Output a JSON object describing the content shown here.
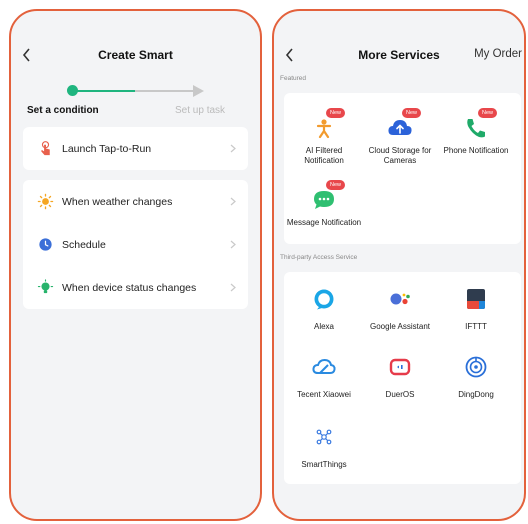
{
  "left": {
    "title": "Create Smart",
    "steps": {
      "step1": "Set a condition",
      "step2": "Set up task"
    },
    "card1": [
      {
        "label": "Launch Tap-to-Run",
        "icon": "hand-tap-icon"
      }
    ],
    "card2": [
      {
        "label": "When weather changes",
        "icon": "sun-icon"
      },
      {
        "label": "Schedule",
        "icon": "clock-icon"
      },
      {
        "label": "When device status changes",
        "icon": "device-icon"
      }
    ]
  },
  "right": {
    "title": "More Services",
    "my_order": "My Order",
    "featured_label": "Featured",
    "featured": [
      {
        "label": "AI Filtered Notification",
        "badge": "New"
      },
      {
        "label": "Cloud Storage for Cameras",
        "badge": "New"
      },
      {
        "label": "Phone Notification",
        "badge": "New"
      },
      {
        "label": "Message Notification",
        "badge": "New"
      }
    ],
    "third_party_label": "Third-party Access Service",
    "third_party": [
      {
        "label": "Alexa"
      },
      {
        "label": "Google Assistant"
      },
      {
        "label": "IFTTT"
      },
      {
        "label": "Tecent Xiaowei"
      },
      {
        "label": "DuerOS"
      },
      {
        "label": "DingDong"
      },
      {
        "label": "SmartThings"
      }
    ]
  },
  "colors": {
    "accent": "#1fb57f",
    "frame": "#e3613c",
    "badge": "#e8474b"
  }
}
